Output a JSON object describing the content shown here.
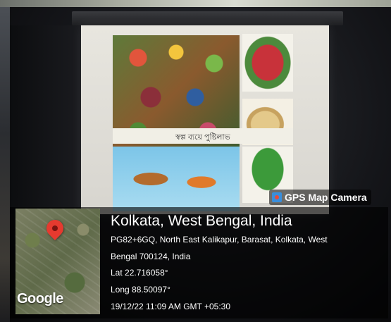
{
  "slide": {
    "caption": "স্বল্প ব্যয়ে পুষ্টিলাভ"
  },
  "overlay": {
    "badge_label": "GPS Map Camera",
    "location_title": "Kolkata, West Bengal, India",
    "address_line1": "PG82+6GQ, North East Kalikapur, Barasat, Kolkata, West",
    "address_line2": "Bengal 700124, India",
    "latitude": "Lat 22.716058°",
    "longitude": "Long 88.50097°",
    "timestamp": "19/12/22 11:09 AM GMT +05:30",
    "map_logo": "Google"
  },
  "colors": {
    "pin": "#e53a2f",
    "badge_icon": "#3a8edb"
  },
  "icons": {
    "badge": "camera-icon",
    "map": "location-pin-icon"
  }
}
